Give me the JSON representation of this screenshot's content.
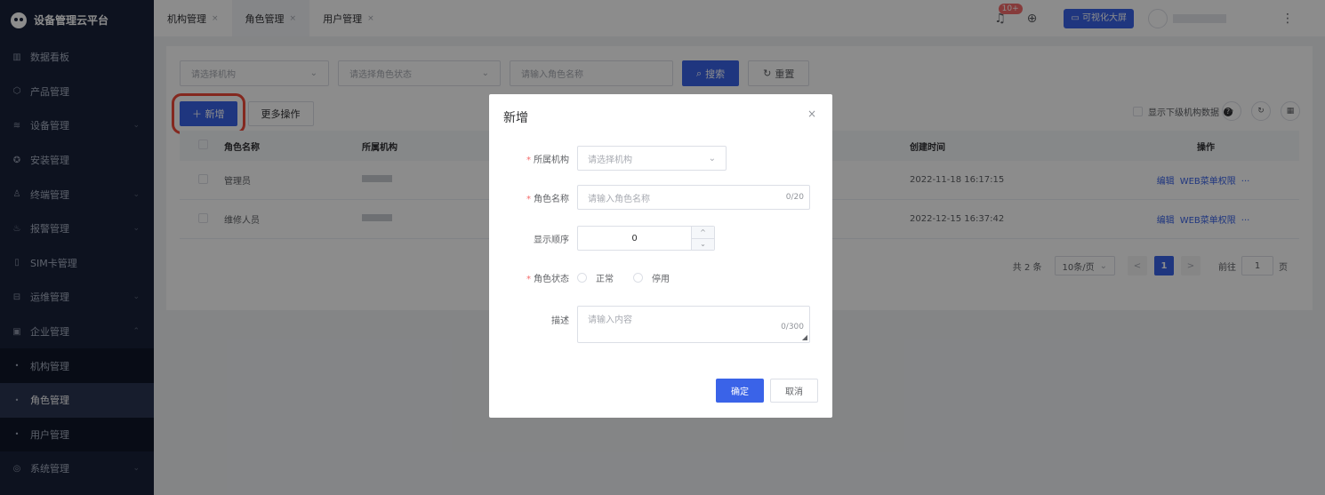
{
  "app": {
    "title": "设备管理云平台"
  },
  "sidebar": {
    "items": [
      {
        "label": "数据看板",
        "icon": "bar-chart-icon",
        "glyph": "▥"
      },
      {
        "label": "产品管理",
        "icon": "cube-icon",
        "glyph": "⬡"
      },
      {
        "label": "设备管理",
        "icon": "layers-icon",
        "glyph": "≋",
        "expandable": true
      },
      {
        "label": "安装管理",
        "icon": "install-icon",
        "glyph": "✪"
      },
      {
        "label": "终端管理",
        "icon": "user-icon",
        "glyph": "♙",
        "expandable": true
      },
      {
        "label": "报警管理",
        "icon": "alarm-icon",
        "glyph": "♨",
        "expandable": true
      },
      {
        "label": "SIM卡管理",
        "icon": "sim-card-icon",
        "glyph": "▯"
      },
      {
        "label": "运维管理",
        "icon": "tools-icon",
        "glyph": "⊟",
        "expandable": true
      },
      {
        "label": "企业管理",
        "icon": "enterprise-icon",
        "glyph": "▣",
        "expanded": true
      }
    ],
    "sub_items": [
      {
        "label": "机构管理"
      },
      {
        "label": "角色管理",
        "active": true
      },
      {
        "label": "用户管理"
      }
    ],
    "last_item": {
      "label": "系统管理",
      "icon": "settings-icon",
      "glyph": "◎"
    },
    "chevron_down": "⌄",
    "chevron_up": "⌃",
    "dot": "•"
  },
  "tabs": [
    {
      "label": "机构管理",
      "close": "×"
    },
    {
      "label": "角色管理",
      "close": "×",
      "active": true
    },
    {
      "label": "用户管理",
      "close": "×"
    }
  ],
  "header": {
    "notification_count": "10+",
    "bell_glyph": "♫",
    "globe_glyph": "⊕",
    "bigscreen_label": "可视化大屏",
    "more_glyph": "⋮"
  },
  "filters": {
    "org_placeholder": "请选择机构",
    "status_placeholder": "请选择角色状态",
    "name_placeholder": "请输入角色名称",
    "dropdown_glyph": "⌄",
    "search_label": "搜索",
    "search_glyph": "⌕",
    "reset_label": "重置",
    "reset_glyph": "↻"
  },
  "toolbar": {
    "add_label": "＋ 新增",
    "more_label": "更多操作",
    "show_sub_label": "显示下级机构数据",
    "help_glyph": "?",
    "search_glyph": "⌕",
    "refresh_glyph": "↻",
    "grid_glyph": "▦"
  },
  "table": {
    "columns": [
      "角色名称",
      "所属机构",
      "创建时间",
      "操作"
    ],
    "rows": [
      {
        "name": "管理员",
        "created": "2022-11-18 16:17:15"
      },
      {
        "name": "维修人员",
        "created": "2022-12-15 16:37:42"
      }
    ],
    "ops": {
      "edit": "编辑",
      "web_menu": "WEB菜单权限",
      "more": "···"
    }
  },
  "pagination": {
    "total": "共 2 条",
    "page_size": "10条/页",
    "prev": "<",
    "current": "1",
    "next": ">",
    "goto_label": "前往",
    "goto_value": "1",
    "page_suffix": "页"
  },
  "dialog": {
    "title": "新增",
    "close": "×",
    "org_label": "所属机构",
    "org_placeholder": "请选择机构",
    "role_name_label": "角色名称",
    "role_name_placeholder": "请输入角色名称",
    "role_name_count": "0/20",
    "order_label": "显示顺序",
    "order_value": "0",
    "step_up": "^",
    "step_down": "⌄",
    "status_label": "角色状态",
    "status_normal": "正常",
    "status_disabled": "停用",
    "desc_label": "描述",
    "desc_placeholder": "请输入内容",
    "desc_count": "0/300",
    "confirm": "确定",
    "cancel": "取消",
    "required_mark": "*"
  },
  "colors": {
    "primary": "#3a63e8",
    "sidebar_bg": "#19223a",
    "highlight_box": "#f04a3a",
    "badge": "#f56c6c"
  }
}
